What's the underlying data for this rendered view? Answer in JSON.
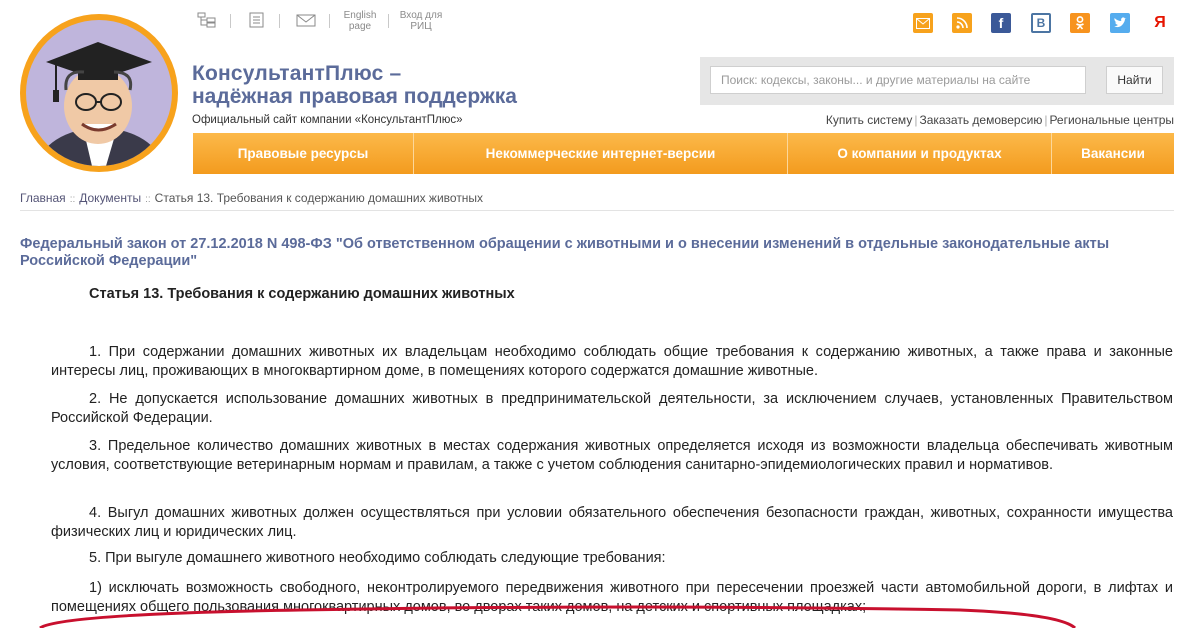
{
  "top_links": {
    "english_line1": "English",
    "english_line2": "page",
    "rits_line1": "Вход для",
    "rits_line2": "РИЦ"
  },
  "brand": {
    "line1": "КонсультантПлюс –",
    "line2": "надёжная правовая поддержка",
    "subtitle": "Официальный сайт компании «КонсультантПлюс»"
  },
  "search": {
    "placeholder": "Поиск: кодексы, законы... и другие материалы на сайте",
    "button": "Найти"
  },
  "sublinks": {
    "buy": "Купить систему",
    "demo": "Заказать демоверсию",
    "regional": "Региональные центры"
  },
  "nav": {
    "item1": "Правовые ресурсы",
    "item2": "Некоммерческие интернет-версии",
    "item3": "О компании и продуктах",
    "item4": "Вакансии"
  },
  "breadcrumb": {
    "home": "Главная",
    "docs": "Документы",
    "current": "Статья 13. Требования к содержанию домашних животных"
  },
  "document": {
    "law_title": "Федеральный закон от 27.12.2018 N 498-ФЗ \"Об ответственном обращении с животными и о внесении изменений в отдельные законодательные акты Российской Федерации\"",
    "article_title": "Статья 13. Требования к содержанию домашних животных",
    "p1": "1. При содержании домашних животных их владельцам необходимо соблюдать общие требования к содержанию животных, а также права и законные интересы лиц, проживающих в многоквартирном доме, в помещениях которого содержатся домашние животные.",
    "p2": "2. Не допускается использование домашних животных в предпринимательской деятельности, за исключением случаев, установленных Правительством Российской Федерации.",
    "p3": "3. Предельное количество домашних животных в местах содержания животных определяется исходя из возможности владельца обеспечивать животным условия, соответствующие ветеринарным нормам и правилам, а также с учетом соблюдения санитарно-эпидемиологических правил и нормативов.",
    "p4": "4. Выгул домашних животных должен осуществляться при условии обязательного обеспечения безопасности граждан, животных, сохранности имущества физических лиц и юридических лиц.",
    "p5": "5. При выгуле домашнего животного необходимо соблюдать следующие требования:",
    "p6": "1) исключать возможность свободного, неконтролируемого передвижения животного при пересечении проезжей части автомобильной дороги, в лифтах и помещениях общего пользования многоквартирных домов, во дворах таких домов, на детских и спортивных площадках;"
  },
  "colors": {
    "accent_orange": "#f7a21c",
    "brand_blue": "#5b6b9a",
    "highlight_red": "#c8102e"
  }
}
